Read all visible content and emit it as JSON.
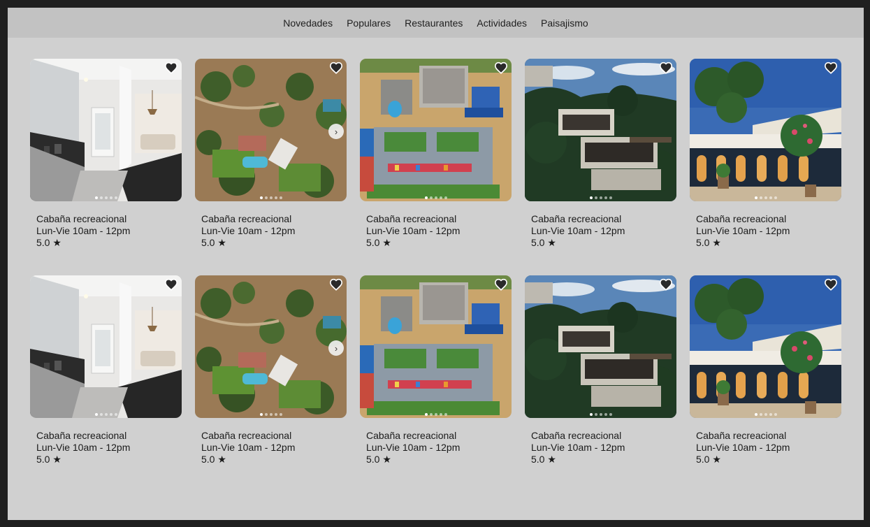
{
  "nav": {
    "items": [
      "Novedades",
      "Populares",
      "Restaurantes",
      "Actividades",
      "Paisajismo"
    ]
  },
  "listings": [
    {
      "title": "Cabaña recreacional",
      "hours": "Lun-Vie 10am - 12pm",
      "rating": "5.0 ★",
      "scene": "kitchen",
      "has_next": false
    },
    {
      "title": "Cabaña recreacional",
      "hours": "Lun-Vie 10am - 12pm",
      "rating": "5.0 ★",
      "scene": "aerial-estate",
      "has_next": true
    },
    {
      "title": "Cabaña recreacional",
      "hours": "Lun-Vie 10am - 12pm",
      "rating": "5.0 ★",
      "scene": "aerial-playground",
      "has_next": false
    },
    {
      "title": "Cabaña recreacional",
      "hours": "Lun-Vie 10am - 12pm",
      "rating": "5.0 ★",
      "scene": "hillside-house",
      "has_next": false
    },
    {
      "title": "Cabaña recreacional",
      "hours": "Lun-Vie 10am - 12pm",
      "rating": "5.0 ★",
      "scene": "restaurant-night",
      "has_next": false
    },
    {
      "title": "Cabaña recreacional",
      "hours": "Lun-Vie 10am - 12pm",
      "rating": "5.0 ★",
      "scene": "kitchen",
      "has_next": false
    },
    {
      "title": "Cabaña recreacional",
      "hours": "Lun-Vie 10am - 12pm",
      "rating": "5.0 ★",
      "scene": "aerial-estate",
      "has_next": true
    },
    {
      "title": "Cabaña recreacional",
      "hours": "Lun-Vie 10am - 12pm",
      "rating": "5.0 ★",
      "scene": "aerial-playground",
      "has_next": false
    },
    {
      "title": "Cabaña recreacional",
      "hours": "Lun-Vie 10am - 12pm",
      "rating": "5.0 ★",
      "scene": "hillside-house",
      "has_next": false
    },
    {
      "title": "Cabaña recreacional",
      "hours": "Lun-Vie 10am - 12pm",
      "rating": "5.0 ★",
      "scene": "restaurant-night",
      "has_next": false
    }
  ],
  "carousel": {
    "dot_count": 5,
    "active_index": 0
  },
  "icons": {
    "favorite": "heart-icon",
    "next": "chevron-right-icon"
  },
  "colors": {
    "page_bg": "#d0d0d0",
    "nav_bg": "#c2c2c2",
    "frame": "#1f1f1f"
  }
}
